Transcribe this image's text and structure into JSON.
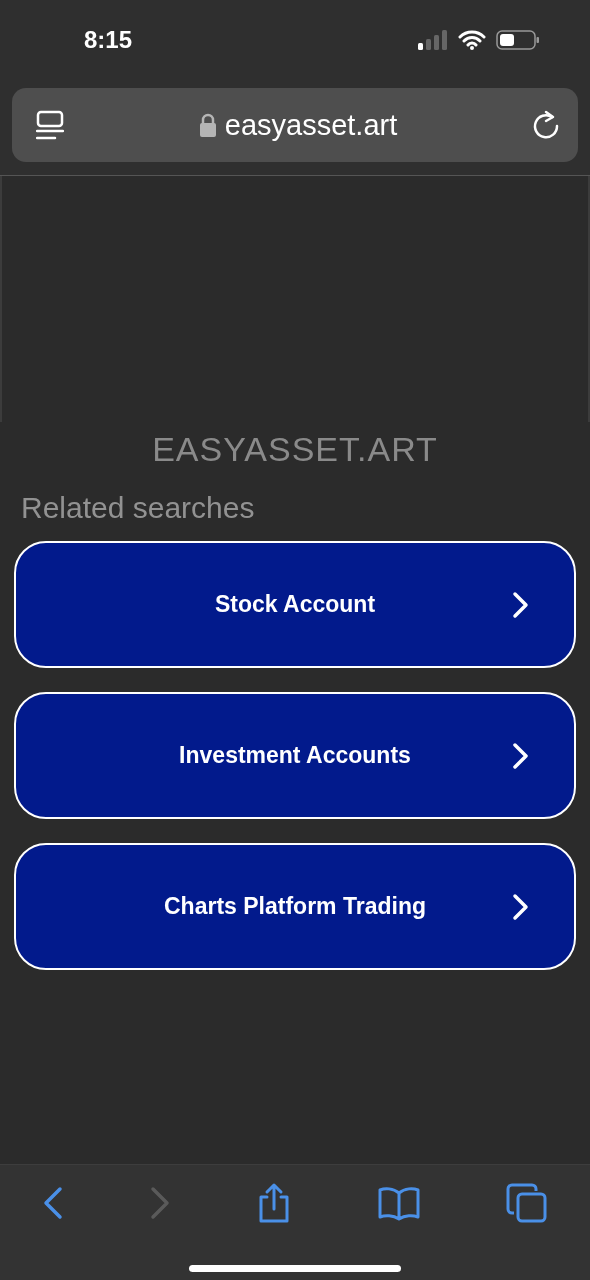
{
  "status_bar": {
    "time": "8:15"
  },
  "address_bar": {
    "url": "easyasset.art"
  },
  "page": {
    "site_title": "EASYASSET.ART",
    "section_title": "Related searches",
    "searches": [
      {
        "label": "Stock Account"
      },
      {
        "label": "Investment Accounts"
      },
      {
        "label": "Charts Platform Trading"
      }
    ]
  },
  "toolbar": {
    "back": {
      "disabled": false
    },
    "forward": {
      "disabled": true
    }
  }
}
